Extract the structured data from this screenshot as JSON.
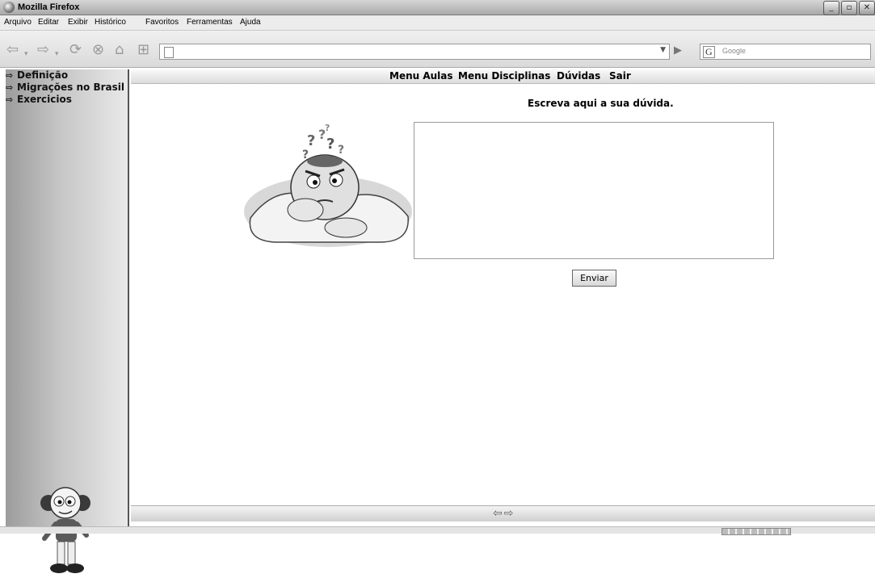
{
  "window": {
    "title": "Mozilla Firefox"
  },
  "menubar": {
    "items": [
      "Arquivo",
      "Editar",
      "Exibir",
      "Histórico",
      "Favoritos",
      "Ferramentas",
      "Ajuda"
    ]
  },
  "toolbar": {
    "icons": [
      "back-icon",
      "forward-icon",
      "reload-icon",
      "stop-icon",
      "home-icon",
      "new-tab-icon"
    ],
    "address_value": "",
    "search_engine": "G",
    "search_placeholder": "Google"
  },
  "sidebar": {
    "items": [
      "Definição",
      "Migrações no Brasil",
      "Exercicios"
    ]
  },
  "topnav": {
    "items": [
      "Menu Aulas",
      "Menu Disciplinas",
      "Dúvidas",
      "Sair"
    ]
  },
  "main": {
    "prompt": "Escreva aqui a sua dúvida.",
    "question_value": "",
    "send_label": "Enviar"
  },
  "footer": {
    "arrows": "⇦⇨"
  }
}
